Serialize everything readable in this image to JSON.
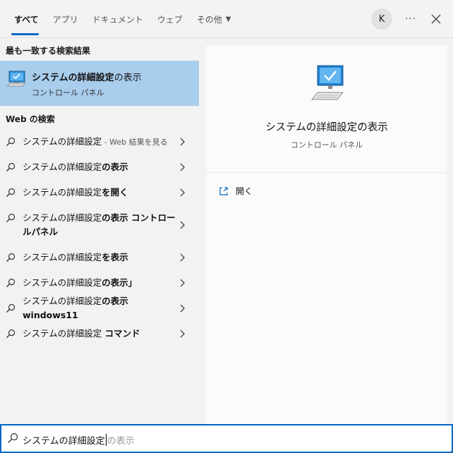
{
  "tabs": [
    {
      "label": "すべて",
      "active": true
    },
    {
      "label": "アプリ",
      "active": false
    },
    {
      "label": "ドキュメント",
      "active": false
    },
    {
      "label": "ウェブ",
      "active": false
    },
    {
      "label": "その他",
      "active": false,
      "dropdown": true
    }
  ],
  "header": {
    "avatar_initial": "K",
    "more_label": "···",
    "close_icon": "close-icon"
  },
  "best_match": {
    "section_label": "最も一致する検索結果",
    "title_bold": "システムの詳細設定",
    "title_rest": "の表示",
    "subtitle": "コントロール パネル",
    "icon": "monitor-check-icon"
  },
  "web_search": {
    "section_label": "Web の検索",
    "items": [
      {
        "typed": "システムの詳細設定",
        "suggestion": "",
        "hint": " - Web 結果を見る"
      },
      {
        "typed": "システムの詳細設定",
        "suggestion": "の表示",
        "hint": ""
      },
      {
        "typed": "システムの詳細設定",
        "suggestion": "を開く",
        "hint": ""
      },
      {
        "typed": "システムの詳細設定",
        "suggestion": "の表示 コントロールパネル",
        "hint": ""
      },
      {
        "typed": "システムの詳細設定",
        "suggestion": "を表示",
        "hint": ""
      },
      {
        "typed": "システムの詳細設定",
        "suggestion": "の表示」",
        "hint": ""
      },
      {
        "typed": "システムの詳細設定",
        "suggestion": "の表示 windows11",
        "hint": ""
      },
      {
        "typed": "システムの詳細設定",
        "suggestion": " コマンド",
        "hint": ""
      }
    ]
  },
  "preview": {
    "title": "システムの詳細設定の表示",
    "subtitle": "コントロール パネル",
    "actions": [
      {
        "label": "開く",
        "icon": "open-icon"
      }
    ]
  },
  "search": {
    "query": "システムの詳細設定",
    "autocomplete": "の表示"
  },
  "colors": {
    "accent": "#0067c0",
    "selected_bg": "#a9cdec",
    "pane_bg": "#fbfbfb"
  }
}
